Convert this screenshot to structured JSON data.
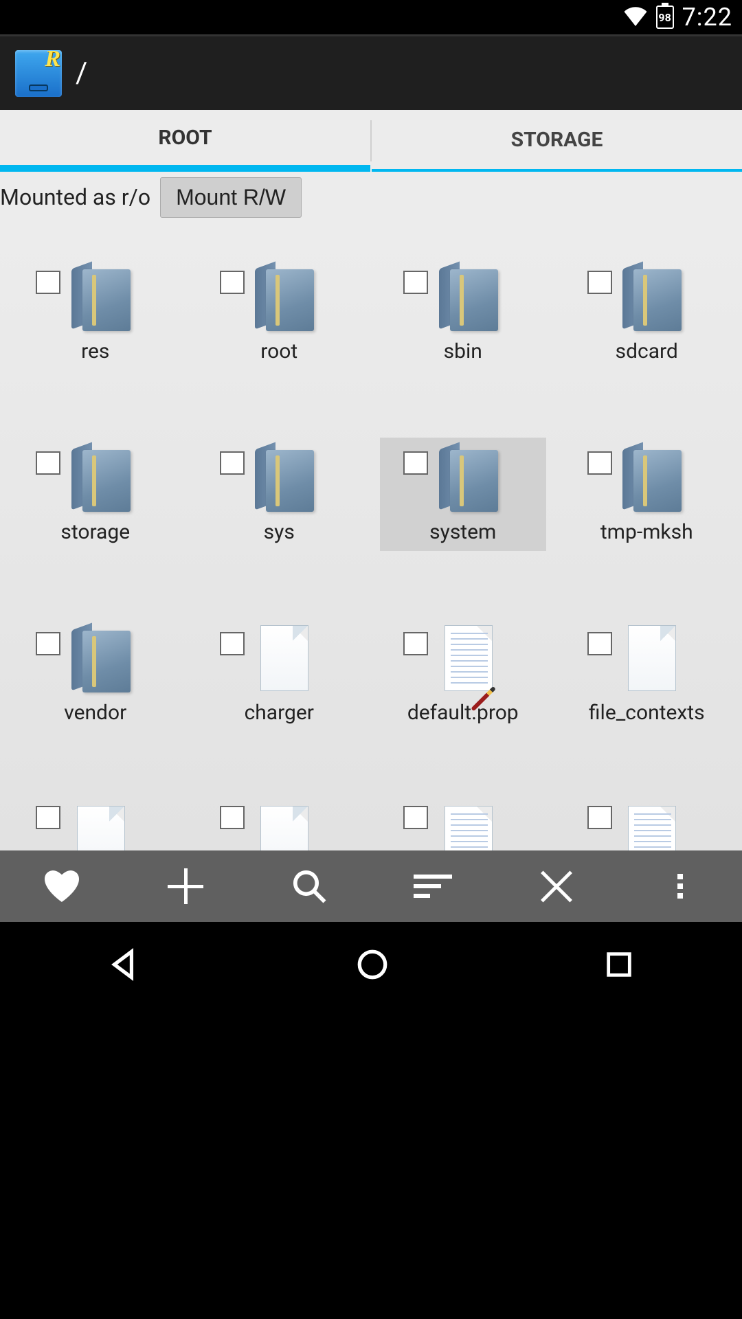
{
  "status": {
    "battery": "98",
    "time": "7:22"
  },
  "appbar": {
    "path": "/"
  },
  "tabs": {
    "root": "ROOT",
    "storage": "STORAGE",
    "activeIndex": 0
  },
  "mount": {
    "status": "Mounted as r/o",
    "button": "Mount R/W"
  },
  "items": [
    {
      "name": "res",
      "type": "folder",
      "selected": false
    },
    {
      "name": "root",
      "type": "folder",
      "selected": false
    },
    {
      "name": "sbin",
      "type": "folder",
      "selected": false
    },
    {
      "name": "sdcard",
      "type": "folder",
      "selected": false
    },
    {
      "name": "storage",
      "type": "folder",
      "selected": false
    },
    {
      "name": "sys",
      "type": "folder",
      "selected": false
    },
    {
      "name": "system",
      "type": "folder",
      "selected": true
    },
    {
      "name": "tmp-mksh",
      "type": "folder",
      "selected": false
    },
    {
      "name": "vendor",
      "type": "folder",
      "selected": false
    },
    {
      "name": "charger",
      "type": "file-blank",
      "selected": false
    },
    {
      "name": "default.prop",
      "type": "file-lined",
      "selected": false
    },
    {
      "name": "file_contexts",
      "type": "file-blank",
      "selected": false
    },
    {
      "name": "",
      "type": "file-blank",
      "selected": false
    },
    {
      "name": "",
      "type": "file-blank",
      "selected": false
    },
    {
      "name": "",
      "type": "file-lined",
      "selected": false
    },
    {
      "name": "",
      "type": "file-lined",
      "selected": false
    }
  ],
  "toolbar": {
    "favorite": "favorite",
    "add": "add",
    "search": "search",
    "sort": "sort",
    "close": "close",
    "more": "more"
  },
  "nav": {
    "back": "back",
    "home": "home",
    "recent": "recent"
  }
}
